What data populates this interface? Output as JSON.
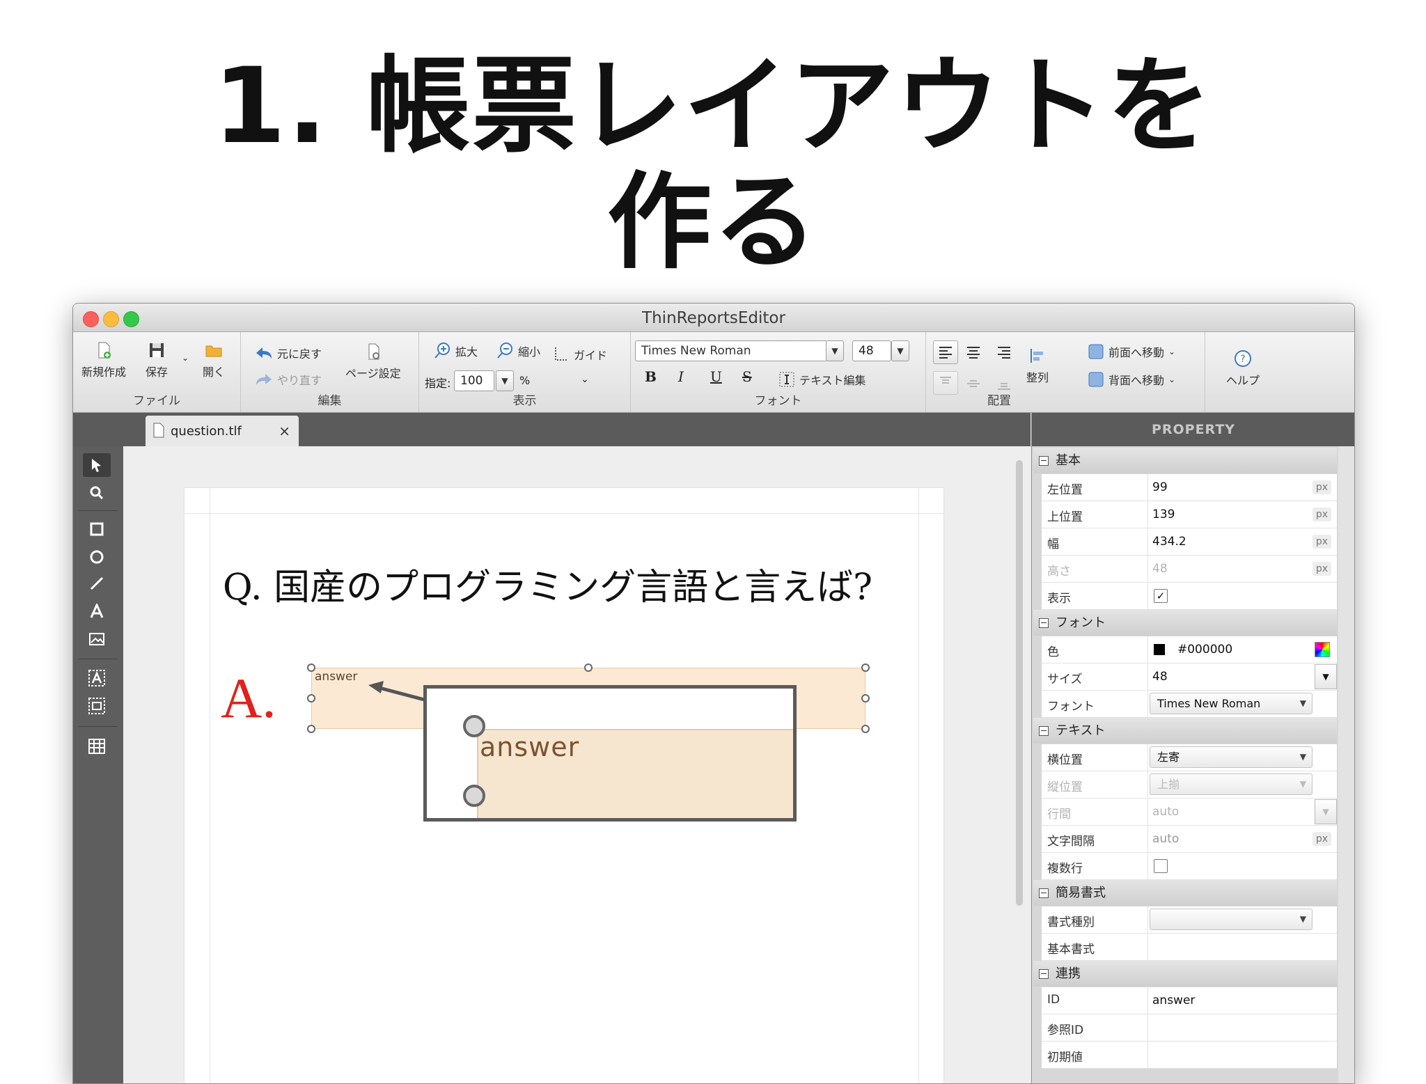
{
  "slide": {
    "title_line1": "1. 帳票レイアウトを",
    "title_line2": "作る"
  },
  "window": {
    "title": "ThinReportsEditor"
  },
  "toolbar": {
    "file": {
      "new": "新規作成",
      "save": "保存",
      "open": "開く",
      "label": "ファイル"
    },
    "edit": {
      "undo": "元に戻す",
      "redo": "やり直す",
      "page_setup": "ページ設定",
      "label": "編集"
    },
    "view": {
      "zoom_in": "拡大",
      "zoom_out": "縮小",
      "guide": "ガイド",
      "zoom_label": "指定:",
      "zoom_value": "100",
      "zoom_unit": "%",
      "label": "表示"
    },
    "font": {
      "family": "Times New Roman",
      "size": "48",
      "bold": "B",
      "italic": "I",
      "underline": "U",
      "strike": "S",
      "text_edit": "テキスト編集",
      "label": "フォント"
    },
    "arrange": {
      "align": "整列",
      "front": "前面へ移動",
      "back": "背面へ移動",
      "label": "配置"
    },
    "help": {
      "label": "ヘルプ"
    }
  },
  "tab": {
    "filename": "question.tlf",
    "close": "×"
  },
  "canvas": {
    "question": "Q. 国産のプログラミング言語と言えば?",
    "answer_prefix": "A.",
    "text_block_label": "answer",
    "zoom_text": "answer"
  },
  "panel": {
    "header": "PROPERTY",
    "basic": {
      "title": "基本",
      "left": {
        "name": "左位置",
        "value": "99",
        "unit": "px"
      },
      "top": {
        "name": "上位置",
        "value": "139",
        "unit": "px"
      },
      "width": {
        "name": "幅",
        "value": "434.2",
        "unit": "px"
      },
      "height": {
        "name": "高さ",
        "value": "48",
        "unit": "px"
      },
      "visible": {
        "name": "表示",
        "checked": "✓"
      }
    },
    "font": {
      "title": "フォント",
      "color": {
        "name": "色",
        "value": "#000000"
      },
      "size": {
        "name": "サイズ",
        "value": "48"
      },
      "family": {
        "name": "フォント",
        "value": "Times New Roman"
      }
    },
    "text": {
      "title": "テキスト",
      "halign": {
        "name": "横位置",
        "value": "左寄"
      },
      "valign": {
        "name": "縦位置",
        "value": "上揃"
      },
      "line_height": {
        "name": "行間",
        "value": "auto"
      },
      "letter_spacing": {
        "name": "文字間隔",
        "value": "auto",
        "unit": "px"
      },
      "multiline": {
        "name": "複数行"
      }
    },
    "format": {
      "title": "簡易書式",
      "type": {
        "name": "書式種別",
        "value": ""
      },
      "base": {
        "name": "基本書式",
        "value": ""
      }
    },
    "link": {
      "title": "連携",
      "id": {
        "name": "ID",
        "value": "answer"
      },
      "ref_id": {
        "name": "参照ID",
        "value": ""
      },
      "default": {
        "name": "初期値",
        "value": ""
      }
    }
  },
  "colors": {
    "answer_red": "#e3201b",
    "block_fill": "#fbe9d4",
    "dark_chrome": "#5b5b5b"
  }
}
